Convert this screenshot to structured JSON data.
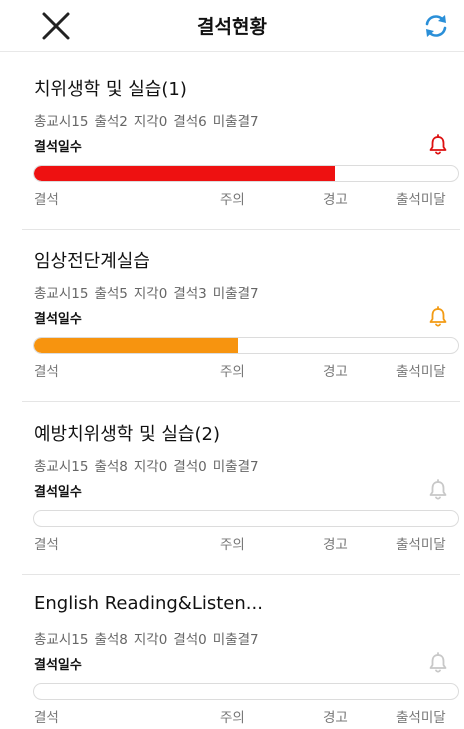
{
  "header": {
    "title": "결석현황"
  },
  "scale_labels": [
    "결석",
    "주의",
    "경고",
    "출석미달"
  ],
  "courses": [
    {
      "name": "치위생학 및 실습(1)",
      "total": "총교시15",
      "present": "출석2",
      "late": "지각0",
      "absent": "결석6",
      "unchecked": "미출결7",
      "bar_label": "결석일수",
      "progress": 0.71,
      "bar_color": "#ee1111",
      "bell_color": "#dd1111"
    },
    {
      "name": "임상전단계실습",
      "total": "총교시15",
      "present": "출석5",
      "late": "지각0",
      "absent": "결석3",
      "unchecked": "미출결7",
      "bar_label": "결석일수",
      "progress": 0.48,
      "bar_color": "#f7940f",
      "bell_color": "#f39b14"
    },
    {
      "name": "예방치위생학 및 실습(2)",
      "total": "총교시15",
      "present": "출석8",
      "late": "지각0",
      "absent": "결석0",
      "unchecked": "미출결7",
      "bar_label": "결석일수",
      "progress": 0,
      "bar_color": "#cccccc",
      "bell_color": "#c8c8c8"
    },
    {
      "name": "English Reading&Listen...",
      "total": "총교시15",
      "present": "출석8",
      "late": "지각0",
      "absent": "결석0",
      "unchecked": "미출결7",
      "bar_label": "결석일수",
      "progress": 0,
      "bar_color": "#cccccc",
      "bell_color": "#c8c8c8"
    }
  ],
  "icons": {
    "close": "close-icon",
    "refresh": "refresh-icon",
    "bell": "bell-icon"
  },
  "colors": {
    "refresh": "#2a8fd8",
    "divider": "#e5e5e5"
  }
}
